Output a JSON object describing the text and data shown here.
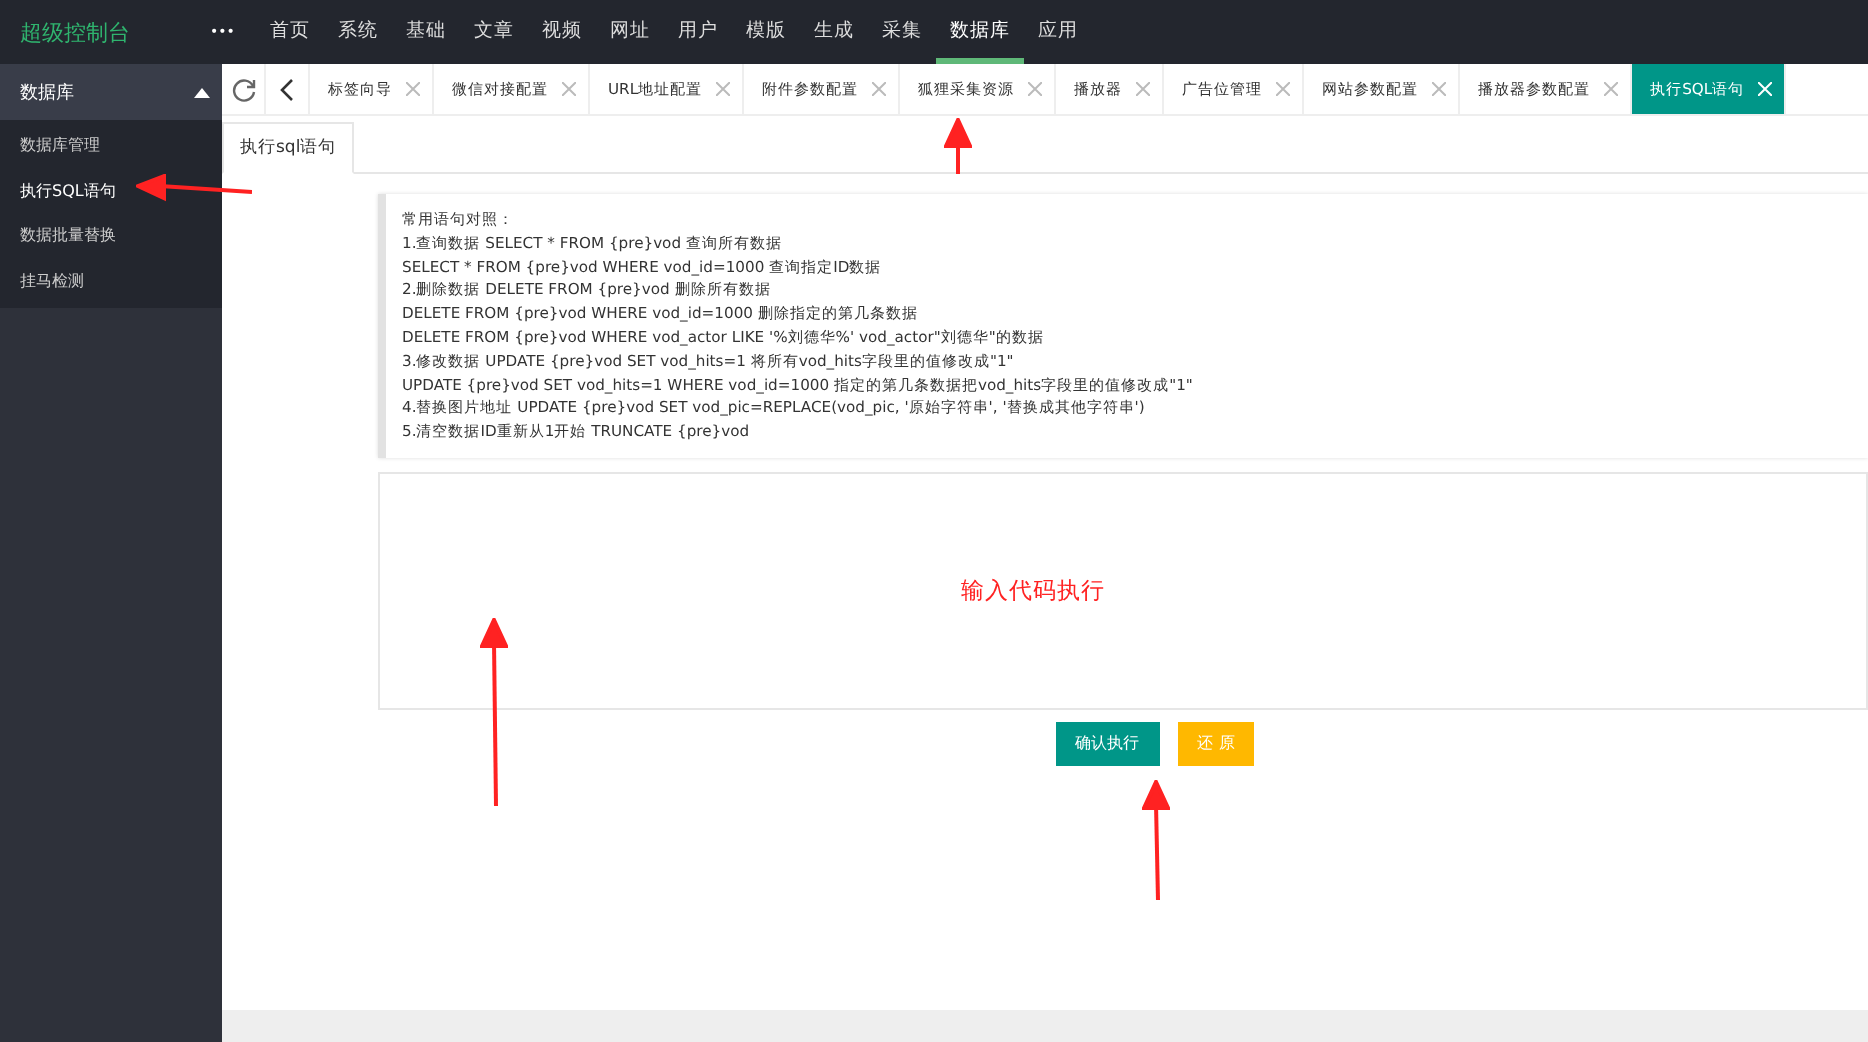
{
  "logo": "超级控制台",
  "more": "•••",
  "nav": [
    {
      "label": "首页",
      "selected": false
    },
    {
      "label": "系统",
      "selected": false
    },
    {
      "label": "基础",
      "selected": false
    },
    {
      "label": "文章",
      "selected": false
    },
    {
      "label": "视频",
      "selected": false
    },
    {
      "label": "网址",
      "selected": false
    },
    {
      "label": "用户",
      "selected": false
    },
    {
      "label": "模版",
      "selected": false
    },
    {
      "label": "生成",
      "selected": false
    },
    {
      "label": "采集",
      "selected": false
    },
    {
      "label": "数据库",
      "selected": true
    },
    {
      "label": "应用",
      "selected": false
    }
  ],
  "sidebar": {
    "title": "数据库",
    "expanded": true,
    "items": [
      {
        "label": "数据库管理",
        "selected": false
      },
      {
        "label": "执行SQL语句",
        "selected": true
      },
      {
        "label": "数据批量替换",
        "selected": false
      },
      {
        "label": "挂马检测",
        "selected": false
      }
    ]
  },
  "tabs": [
    {
      "label": "标签向导",
      "selected": false
    },
    {
      "label": "微信对接配置",
      "selected": false
    },
    {
      "label": "URL地址配置",
      "selected": false
    },
    {
      "label": "附件参数配置",
      "selected": false
    },
    {
      "label": "狐狸采集资源",
      "selected": false
    },
    {
      "label": "播放器",
      "selected": false
    },
    {
      "label": "广告位管理",
      "selected": false
    },
    {
      "label": "网站参数配置",
      "selected": false
    },
    {
      "label": "播放器参数配置",
      "selected": false
    },
    {
      "label": "执行SQL语句",
      "selected": true
    }
  ],
  "subtab": "执行sql语句",
  "reference": [
    "常用语句对照：",
    "1.查询数据 SELECT * FROM {pre}vod 查询所有数据",
    "SELECT * FROM {pre}vod WHERE vod_id=1000 查询指定ID数据",
    "2.删除数据 DELETE FROM {pre}vod 删除所有数据",
    "DELETE FROM {pre}vod WHERE vod_id=1000 删除指定的第几条数据",
    "DELETE FROM {pre}vod WHERE vod_actor LIKE '%刘德华%' vod_actor\"刘德华\"的数据",
    "3.修改数据 UPDATE {pre}vod SET vod_hits=1 将所有vod_hits字段里的值修改成\"1\"",
    "UPDATE {pre}vod SET vod_hits=1 WHERE vod_id=1000 指定的第几条数据把vod_hits字段里的值修改成\"1\"",
    "4.替换图片地址 UPDATE {pre}vod SET vod_pic=REPLACE(vod_pic, '原始字符串', '替换成其他字符串')",
    "5.清空数据ID重新从1开始 TRUNCATE {pre}vod"
  ],
  "annotation": "输入代码执行",
  "buttons": [
    {
      "label": "确认执行",
      "kind": "primary"
    },
    {
      "label": "还 原",
      "kind": "warm"
    }
  ]
}
